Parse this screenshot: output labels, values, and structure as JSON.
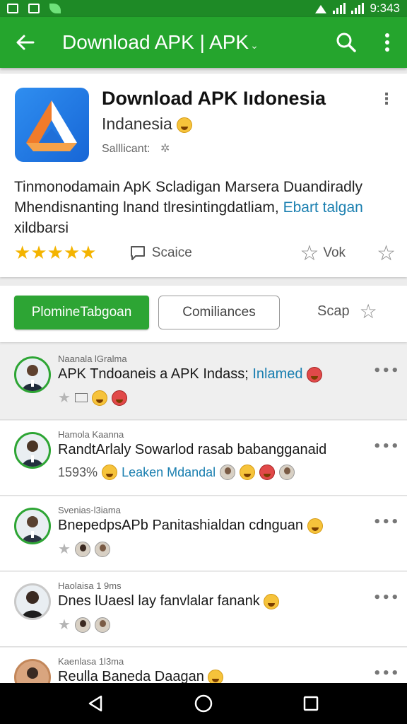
{
  "status_bar": {
    "time": "9:343"
  },
  "toolbar": {
    "title": "Download APK | APK"
  },
  "app": {
    "name": "Download APK Iıdonesia",
    "developer": "Indanesia",
    "meta": "Salllicant:",
    "description_main": "Tinmonodamain ApK Scladigan Marsera Duandiradly Mhendisnanting lnand tlresintingdatliam,",
    "description_link": "Ebart talgan",
    "description_tail": "xildbarsi",
    "rating": 5,
    "share_label": "Scaice",
    "vote_label": "Vok"
  },
  "filters": {
    "primary_label": "PlomineTabgoan",
    "secondary_label": "Comiliances",
    "scap_label": "Scap"
  },
  "comments": [
    {
      "user": "Naanala lGralma",
      "text": "APK Tndoaneis a APK Indass;",
      "link": "Inlamed",
      "meta": "",
      "meta_link": ""
    },
    {
      "user": "Hamola Kaanna",
      "text": "RandtArlaly Sowarlod rasab babangganaid",
      "link": "",
      "meta": "1593%",
      "meta_link": "Leaken Mdandal"
    },
    {
      "user": "Svenias-l3iama",
      "text": "BnepedpsAPb Panitashialdan cdnguan",
      "link": "",
      "meta": "",
      "meta_link": ""
    },
    {
      "user": "Haolaisa 1 9ms",
      "text": "Dnes lUaesl lay fanvlalar fanank",
      "link": "",
      "meta": "",
      "meta_link": ""
    },
    {
      "user": "Kaenlasa 1l3ma",
      "text": "Reulla Baneda Daagan",
      "link": "",
      "meta": "",
      "meta_link": ""
    }
  ],
  "colors": {
    "status_bar": "#1e8a26",
    "toolbar": "#25a52d",
    "primary_button": "#2da534",
    "link": "#1a7fb0",
    "star": "#f4b400"
  },
  "icons": {
    "back": "arrow-left-icon",
    "search": "search-icon",
    "more": "more-vert-icon",
    "share": "comment-icon",
    "vote": "star-outline-icon"
  }
}
